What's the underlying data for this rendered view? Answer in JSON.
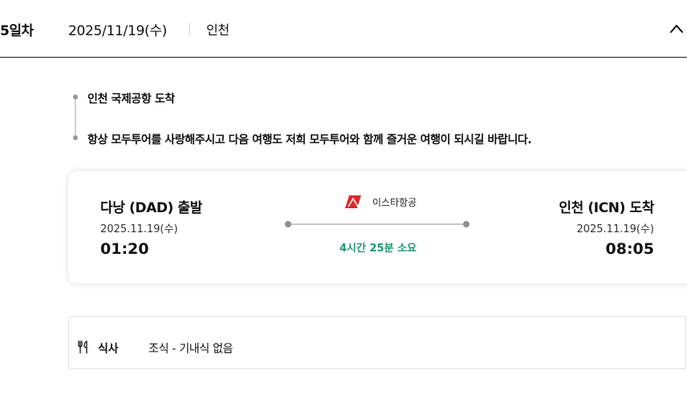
{
  "day_header": {
    "day_label": "5일차",
    "date": "2025/11/19(수)",
    "city": "인천"
  },
  "timeline": [
    {
      "text": "인천 국제공항 도착"
    },
    {
      "text": "항상 모두투어를 사랑해주시고 다음 여행도 저희 모두투어와 함께 즐거운 여행이 되시길 바랍니다."
    }
  ],
  "flight": {
    "departure": {
      "title": "다낭 (DAD) 출발",
      "date": "2025.11.19(수)",
      "time": "01:20"
    },
    "arrival": {
      "title": "인천 (ICN) 도착",
      "date": "2025.11.19(수)",
      "time": "08:05"
    },
    "airline": "이스타항공",
    "duration": "4시간 25분 소요",
    "accent_color": "#1a9b6c",
    "airline_color": "#e0262b"
  },
  "meal": {
    "label": "식사",
    "value": "조식 - 기내식 없음"
  },
  "icons": {
    "collapse": "chevron-up-icon",
    "airline": "airline-logo",
    "meal": "utensils-icon"
  }
}
